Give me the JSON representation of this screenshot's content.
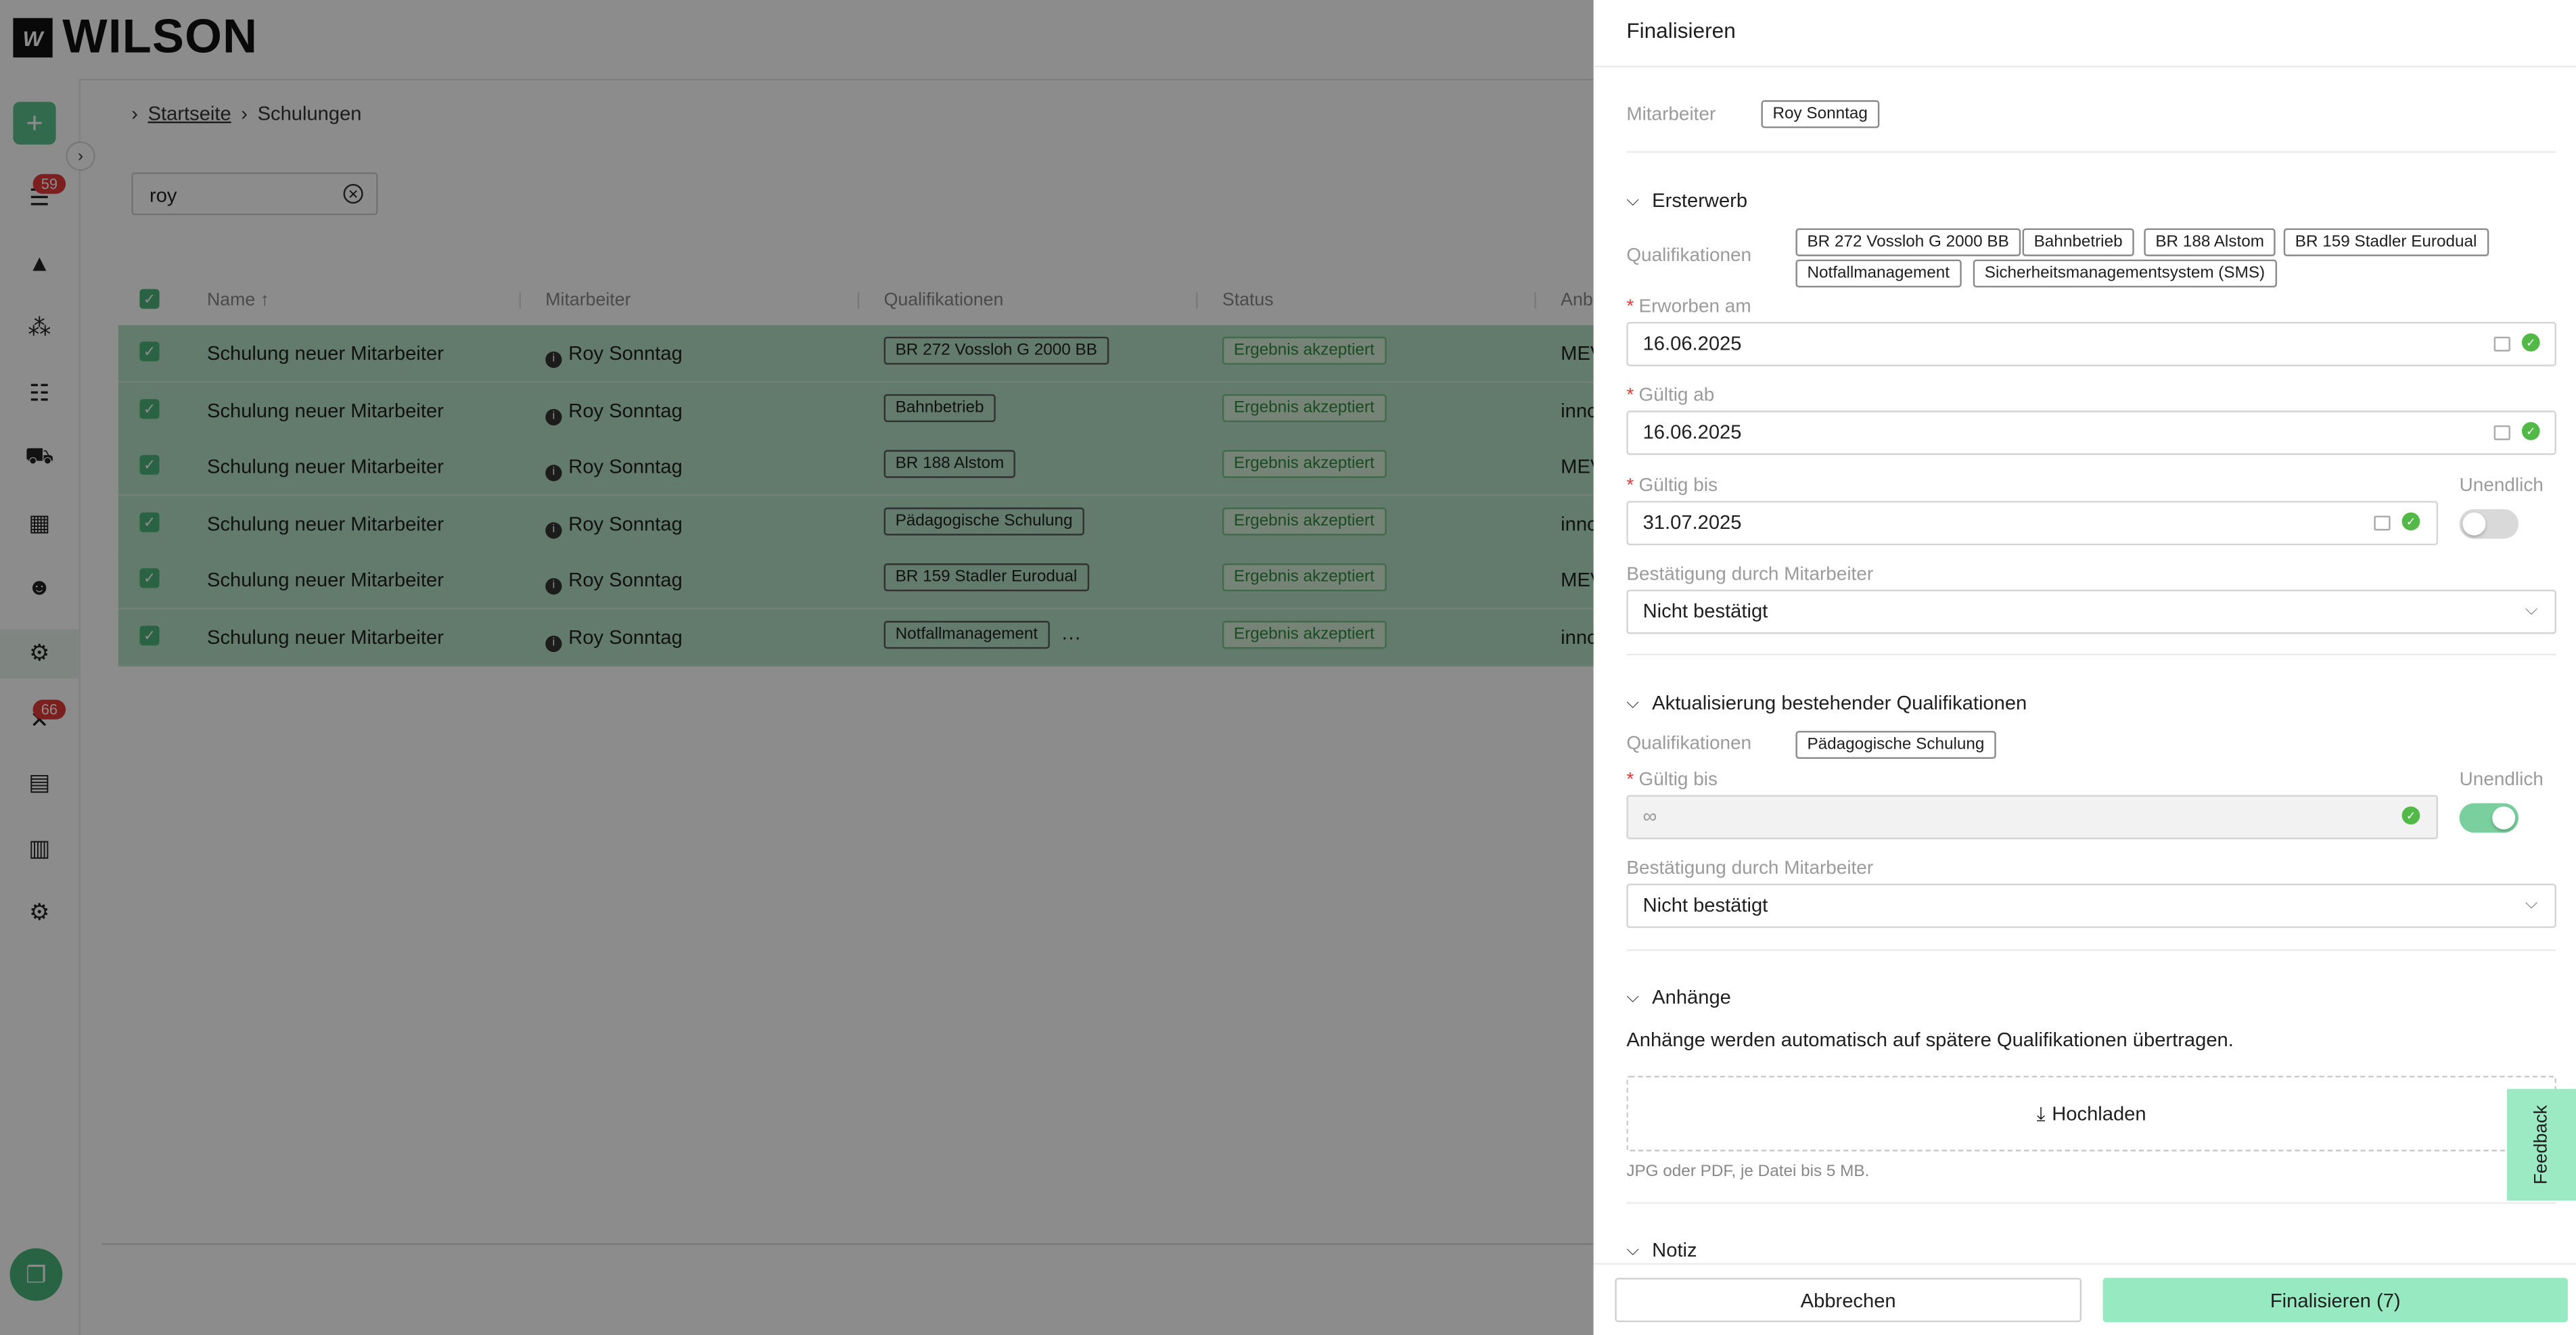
{
  "brand": {
    "name": "WILSON",
    "mark": "W"
  },
  "sidebar": {
    "badges": {
      "tasks": "59",
      "connections": "66"
    }
  },
  "breadcrumb": {
    "home": "Startseite",
    "current": "Schulungen"
  },
  "search": {
    "value": "roy"
  },
  "table": {
    "columns": [
      "Name",
      "Mitarbeiter",
      "Qualifikationen",
      "Status",
      "Anb"
    ],
    "rows": [
      {
        "name": "Schulung neuer Mitarbeiter",
        "employee": "Roy Sonntag",
        "qualification": "BR 272 Vossloh G 2000 BB",
        "status": "Ergebnis akzeptiert",
        "provider": "MEV"
      },
      {
        "name": "Schulung neuer Mitarbeiter",
        "employee": "Roy Sonntag",
        "qualification": "Bahnbetrieb",
        "status": "Ergebnis akzeptiert",
        "provider": "innc"
      },
      {
        "name": "Schulung neuer Mitarbeiter",
        "employee": "Roy Sonntag",
        "qualification": "BR 188 Alstom",
        "status": "Ergebnis akzeptiert",
        "provider": "MEV"
      },
      {
        "name": "Schulung neuer Mitarbeiter",
        "employee": "Roy Sonntag",
        "qualification": "Pädagogische Schulung",
        "status": "Ergebnis akzeptiert",
        "provider": "innc"
      },
      {
        "name": "Schulung neuer Mitarbeiter",
        "employee": "Roy Sonntag",
        "qualification": "BR 159 Stadler Eurodual",
        "status": "Ergebnis akzeptiert",
        "provider": "MEV"
      },
      {
        "name": "Schulung neuer Mitarbeiter",
        "employee": "Roy Sonntag",
        "qualification": "Notfallmanagement",
        "status": "Ergebnis akzeptiert",
        "provider": "innc",
        "more": "···"
      }
    ]
  },
  "drawer": {
    "title": "Finalisieren",
    "employee_label": "Mitarbeiter",
    "employee_value": "Roy Sonntag",
    "ersterwerb": {
      "title": "Ersterwerb",
      "qual_label": "Qualifikationen",
      "quals": [
        "BR 272 Vossloh G 2000 BB",
        "Bahnbetrieb",
        "BR 188 Alstom",
        "BR 159 Stadler Eurodual",
        "Notfallmanagement",
        "Sicherheitsmanagementsystem (SMS)"
      ],
      "acquired_label": "Erworben am",
      "acquired_value": "16.06.2025",
      "valid_from_label": "Gültig ab",
      "valid_from_value": "16.06.2025",
      "valid_to_label": "Gültig bis",
      "valid_to_value": "31.07.2025",
      "infinite_label": "Unendlich",
      "infinite_on": false,
      "confirm_label": "Bestätigung durch Mitarbeiter",
      "confirm_value": "Nicht bestätigt"
    },
    "update": {
      "title": "Aktualisierung bestehender Qualifikationen",
      "qual_label": "Qualifikationen",
      "quals": [
        "Pädagogische Schulung"
      ],
      "valid_to_label": "Gültig bis",
      "valid_to_value": "∞",
      "infinite_label": "Unendlich",
      "infinite_on": true,
      "confirm_label": "Bestätigung durch Mitarbeiter",
      "confirm_value": "Nicht bestätigt"
    },
    "attachments": {
      "title": "Anhänge",
      "info": "Anhänge werden automatisch auf spätere Qualifikationen übertragen.",
      "upload_label": "Hochladen",
      "hint": "JPG oder PDF, je Datei bis 5 MB."
    },
    "note": {
      "title": "Notiz"
    },
    "cancel_label": "Abbrechen",
    "submit_label": "Finalisieren (7)",
    "feedback_label": "Feedback"
  },
  "colors": {
    "accent": "#5ac28a",
    "row_selected": "#b4e0c5",
    "primary_button": "#97e9c1",
    "danger": "#e23b3b"
  }
}
